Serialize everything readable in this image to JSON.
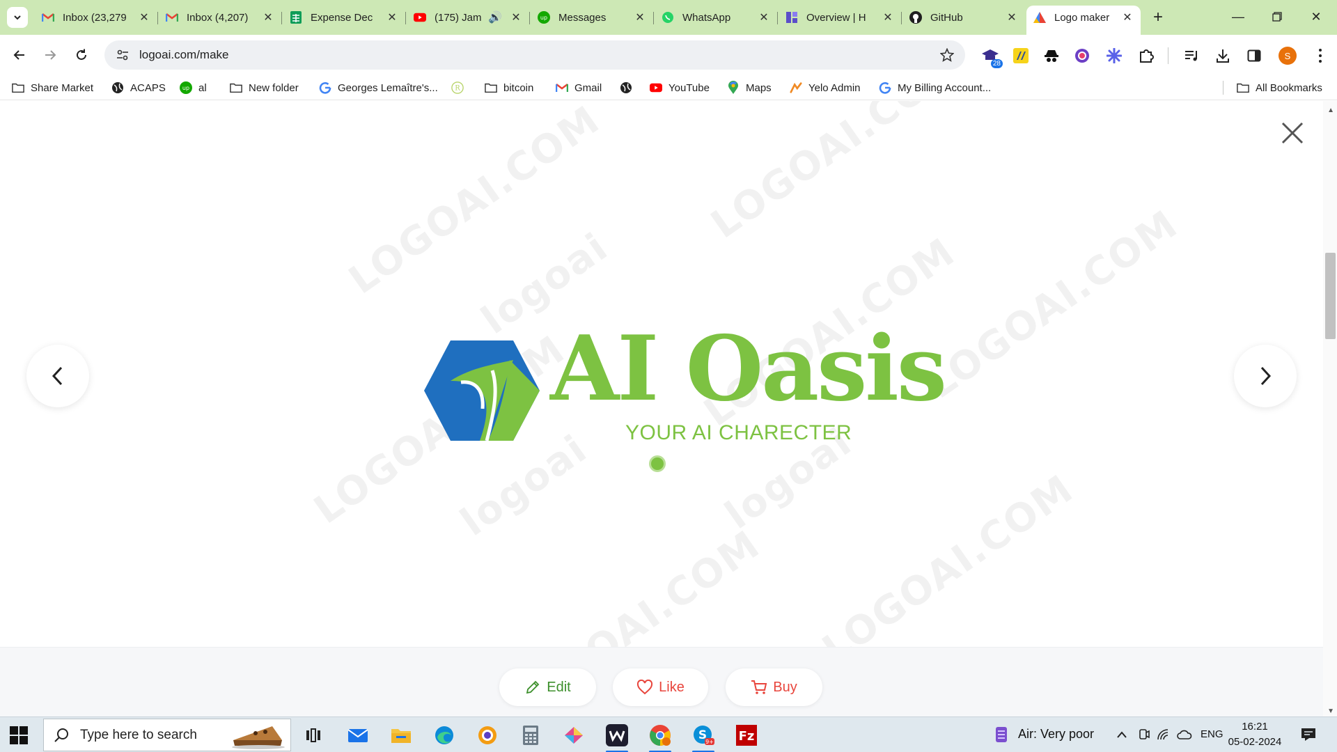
{
  "tabs": [
    {
      "title": "Inbox (23,279",
      "favicon": "gmail-icon"
    },
    {
      "title": "Inbox (4,207)",
      "favicon": "gmail-icon"
    },
    {
      "title": "Expense Dec",
      "favicon": "sheets-icon"
    },
    {
      "title": "(175) Jam",
      "favicon": "youtube-icon"
    },
    {
      "title": "Messages",
      "favicon": "upwork-icon"
    },
    {
      "title": "WhatsApp",
      "favicon": "whatsapp-icon"
    },
    {
      "title": "Overview | H",
      "favicon": "app-icon"
    },
    {
      "title": "GitHub",
      "favicon": "github-icon"
    },
    {
      "title": "Logo maker",
      "favicon": "logoai-icon"
    }
  ],
  "address_bar": {
    "url": "logoai.com/make"
  },
  "profile": {
    "initial": "S"
  },
  "extensions": {
    "badge_count": "28"
  },
  "bookmarks": [
    {
      "label": "Share Market",
      "icon": "folder-icon"
    },
    {
      "label": "ACAPS",
      "icon": "globe-icon"
    },
    {
      "label": "al",
      "icon": "upwork-icon"
    },
    {
      "label": "New folder",
      "icon": "folder-icon"
    },
    {
      "label": "Georges Lemaître's...",
      "icon": "google-icon"
    },
    {
      "label": "",
      "icon": "r-logo-icon"
    },
    {
      "label": "bitcoin",
      "icon": "folder-icon"
    },
    {
      "label": "Gmail",
      "icon": "gmail-icon"
    },
    {
      "label": "",
      "icon": "globe-icon"
    },
    {
      "label": "YouTube",
      "icon": "youtube-icon"
    },
    {
      "label": "Maps",
      "icon": "maps-icon"
    },
    {
      "label": "Yelo Admin",
      "icon": "yelo-icon"
    },
    {
      "label": "My Billing Account...",
      "icon": "google-icon"
    }
  ],
  "all_bookmarks": "All Bookmarks",
  "logo": {
    "title": "AI Oasis",
    "subtitle": "YOUR AI CHARECTER",
    "primary_color": "#7dc242",
    "secondary_color": "#1f6fbf"
  },
  "watermarks": [
    "LOGOAI.COM",
    "logoai"
  ],
  "actions": {
    "edit": "Edit",
    "like": "Like",
    "buy": "Buy"
  },
  "taskbar": {
    "search_placeholder": "Type here to search",
    "weather": "Air: Very poor",
    "language": "ENG",
    "time": "16:21",
    "date": "05-02-2024"
  }
}
